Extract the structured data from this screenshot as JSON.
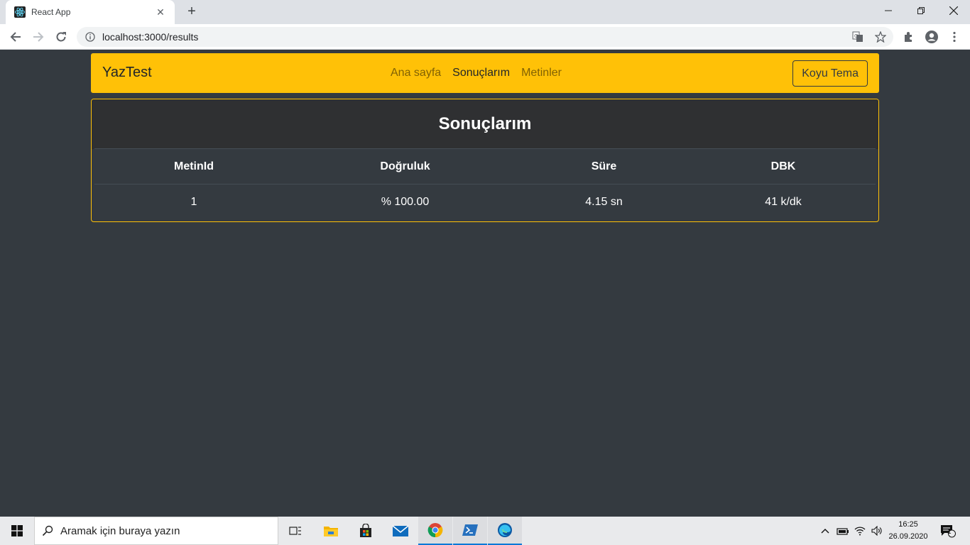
{
  "browser": {
    "tab_title": "React App",
    "url": "localhost:3000/results"
  },
  "app": {
    "brand": "YazTest",
    "nav": [
      {
        "label": "Ana sayfa",
        "active": false
      },
      {
        "label": "Sonuçlarım",
        "active": true
      },
      {
        "label": "Metinler",
        "active": false
      }
    ],
    "theme_button": "Koyu Tema",
    "accent_color": "#ffc107",
    "card_title": "Sonuçlarım",
    "table": {
      "headers": [
        "MetinId",
        "Doğruluk",
        "Süre",
        "DBK"
      ],
      "rows": [
        [
          "1",
          "% 100.00",
          "4.15 sn",
          "41 k/dk"
        ]
      ]
    }
  },
  "taskbar": {
    "search_placeholder": "Aramak için buraya yazın",
    "time": "16:25",
    "date": "26.09.2020",
    "notification_count": "1"
  }
}
